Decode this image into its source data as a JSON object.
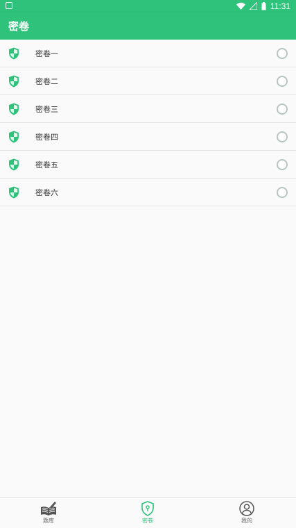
{
  "status_bar": {
    "time": "11:31"
  },
  "app_bar": {
    "title": "密卷"
  },
  "papers": [
    {
      "label": "密卷一"
    },
    {
      "label": "密卷二"
    },
    {
      "label": "密卷三"
    },
    {
      "label": "密卷四"
    },
    {
      "label": "密卷五"
    },
    {
      "label": "密卷六"
    }
  ],
  "bottom_nav": [
    {
      "label": "题库",
      "icon": "book-pen-icon",
      "active": false
    },
    {
      "label": "密卷",
      "icon": "shield-lock-icon",
      "active": true
    },
    {
      "label": "我的",
      "icon": "user-icon",
      "active": false
    }
  ],
  "colors": {
    "accent": "#2ec27a",
    "radio_border": "#b8c4c2"
  }
}
